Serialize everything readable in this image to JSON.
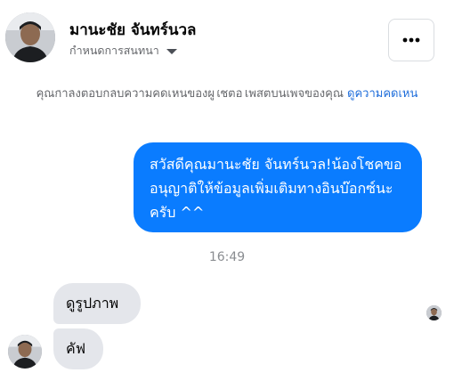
{
  "header": {
    "contact_name": "มานะชัย จันทร์นวล",
    "subtitle": "กำหนดการสนทนา",
    "more_icon": "more-horizontal-icon",
    "avatar_icon": "profile-photo-avatar"
  },
  "notice": {
    "text": "คุณกำลังตอบกลับความคิดเห็นของผู้ใช้ต่อโพสต์บนเพจของคุณ",
    "link": "ดูความคิดเห็น"
  },
  "messages": {
    "outgoing": [
      {
        "text": "สวัสดีคุณมานะชัย จันทร์นวล!น้องโชคขออนุญาติให้ข้อมูลเพิ่มเติมทางอินบ๊อกซ์นะครับ ^^"
      }
    ],
    "timestamp": "16:49",
    "incoming": [
      {
        "text": "ดูรูปภาพ"
      },
      {
        "text": "คัฟ"
      }
    ]
  },
  "colors": {
    "outgoing_bubble": "#0a7cff",
    "incoming_bubble": "#e4e6eb",
    "link": "#216fdb",
    "secondary_text": "#65676b"
  }
}
